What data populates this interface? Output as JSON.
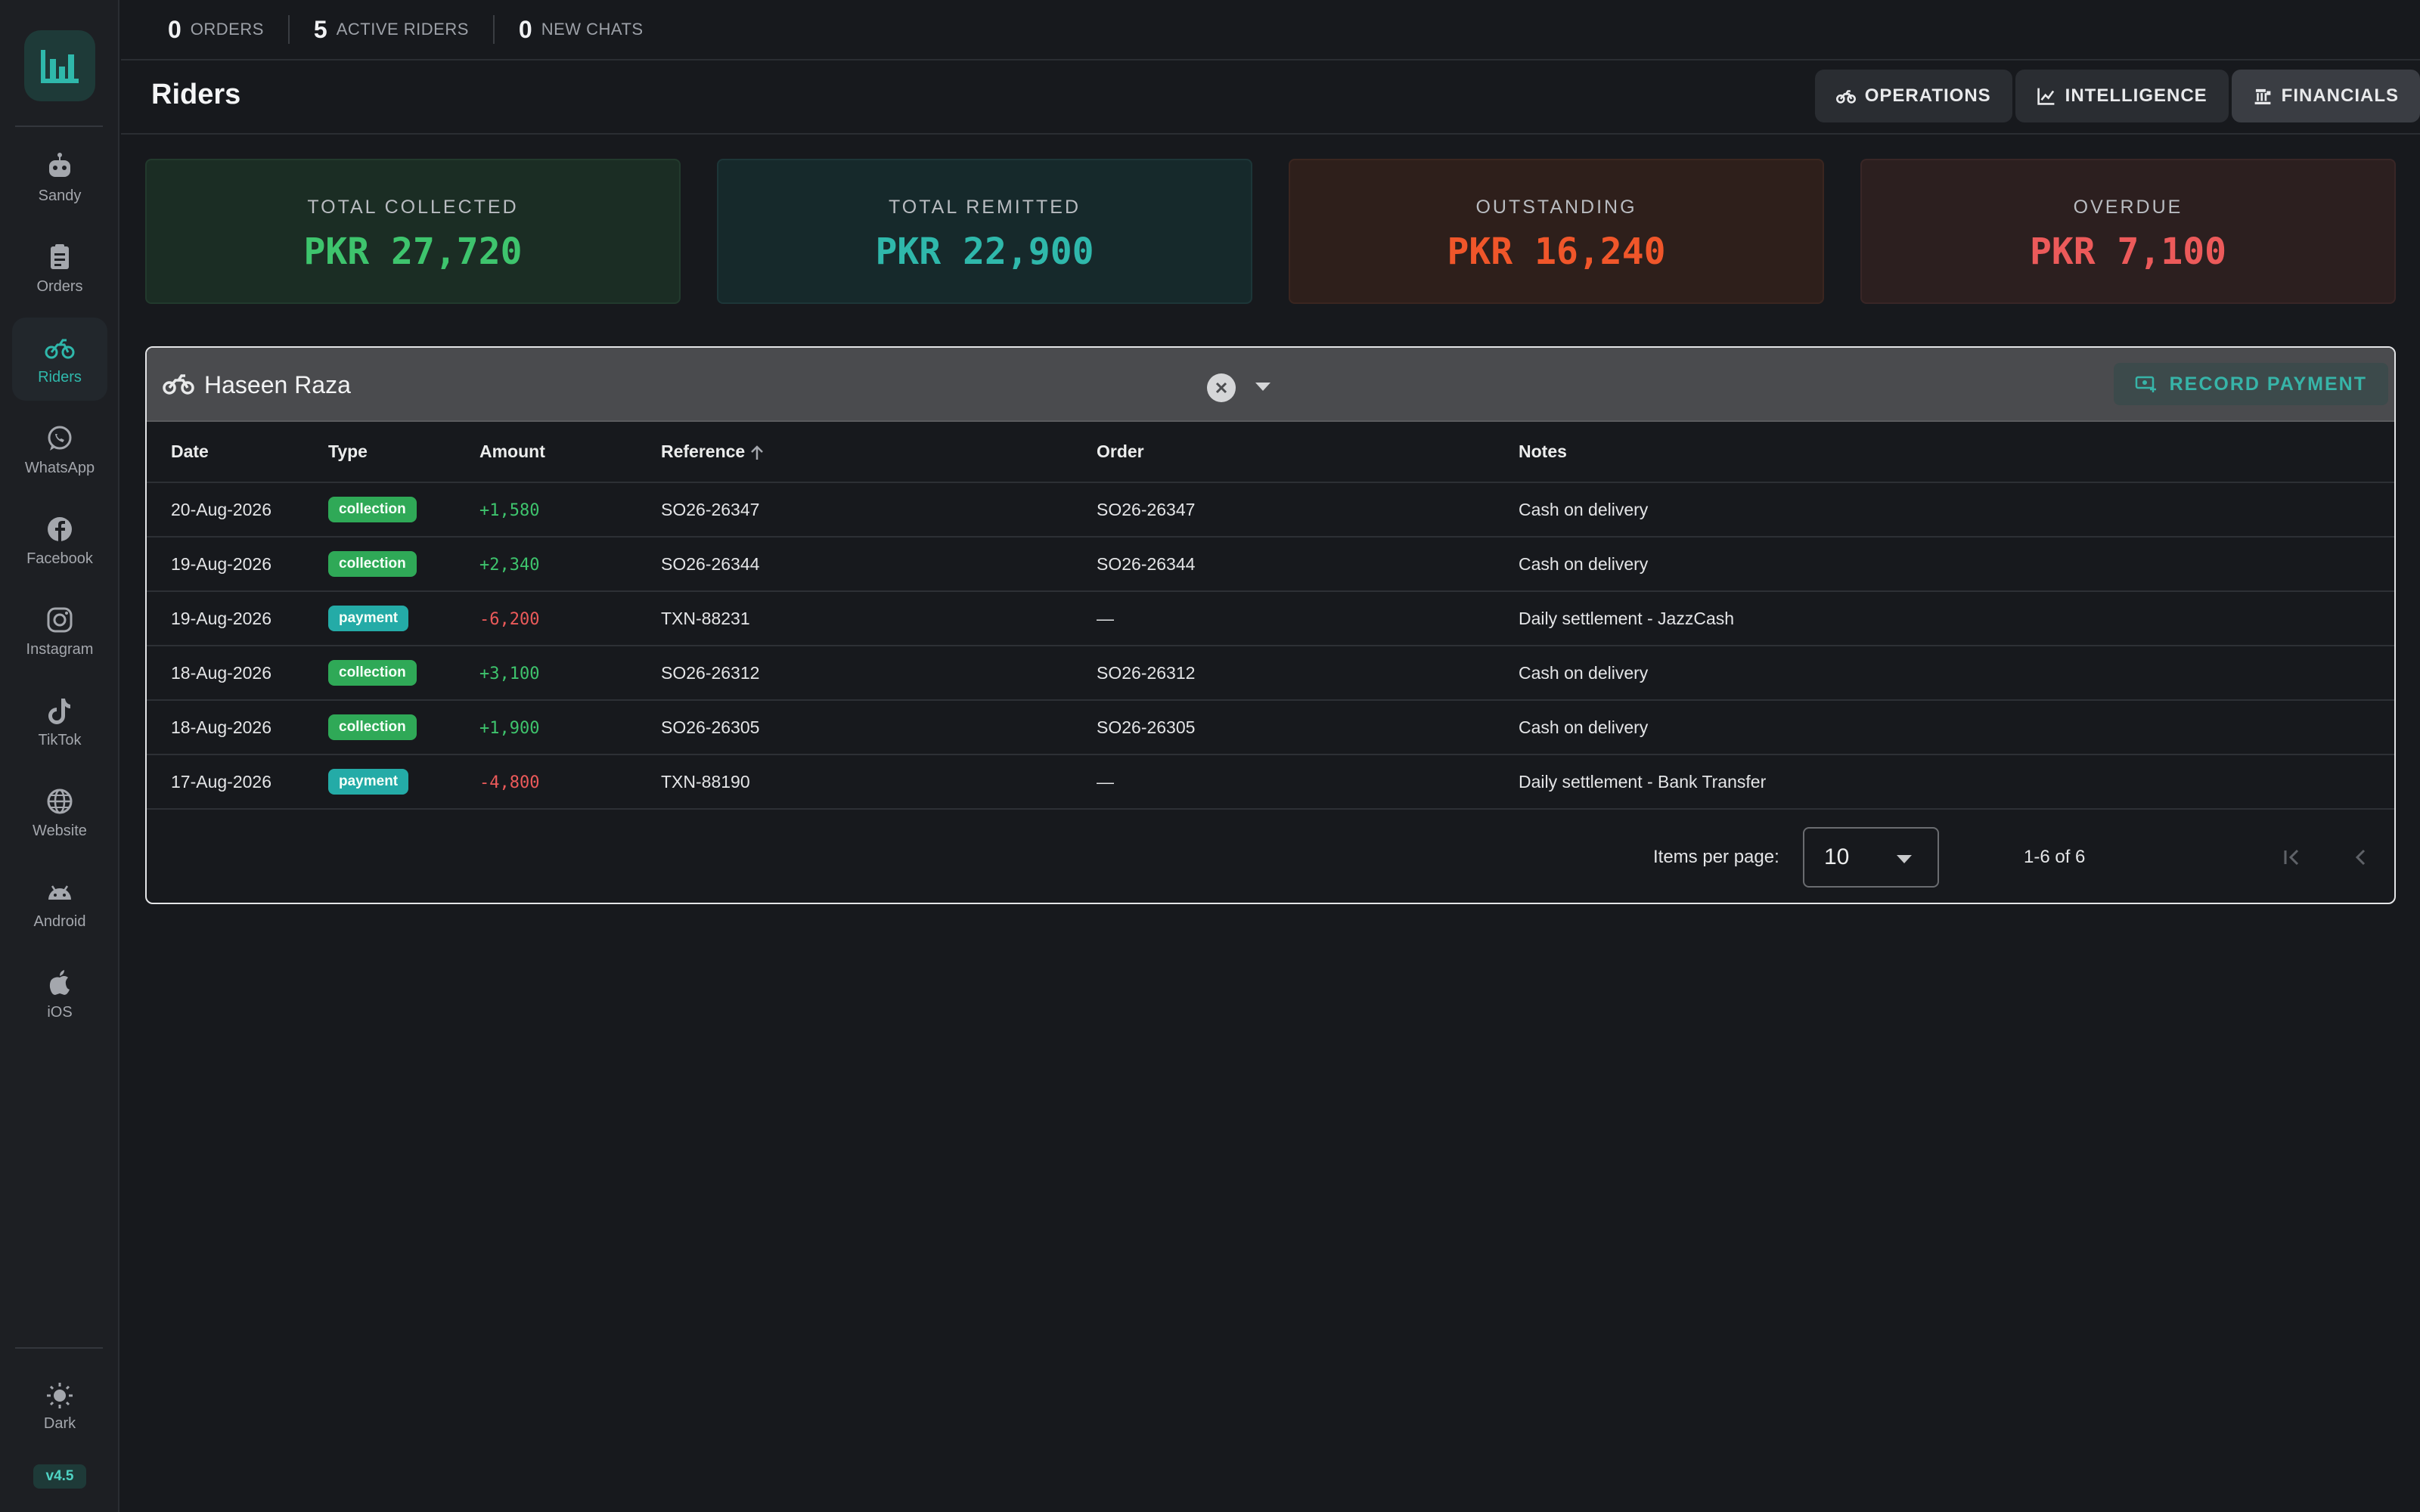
{
  "topbar": {
    "stats": [
      {
        "value": "0",
        "label": "ORDERS"
      },
      {
        "value": "5",
        "label": "ACTIVE RIDERS"
      },
      {
        "value": "0",
        "label": "NEW CHATS"
      }
    ]
  },
  "sidebar": {
    "items": [
      {
        "label": "Sandy",
        "icon": "robot-icon"
      },
      {
        "label": "Orders",
        "icon": "clipboard-icon"
      },
      {
        "label": "Riders",
        "icon": "motorbike-icon",
        "active": true
      },
      {
        "label": "WhatsApp",
        "icon": "whatsapp-icon"
      },
      {
        "label": "Facebook",
        "icon": "facebook-icon"
      },
      {
        "label": "Instagram",
        "icon": "instagram-icon"
      },
      {
        "label": "TikTok",
        "icon": "tiktok-icon"
      },
      {
        "label": "Website",
        "icon": "globe-icon"
      },
      {
        "label": "Android",
        "icon": "android-icon"
      },
      {
        "label": "iOS",
        "icon": "apple-icon"
      }
    ],
    "theme_label": "Dark",
    "version": "v4.5"
  },
  "header": {
    "title": "Riders",
    "tabs": [
      {
        "label": "OPERATIONS",
        "icon": "motorbike-icon"
      },
      {
        "label": "INTELLIGENCE",
        "icon": "line-chart-icon"
      },
      {
        "label": "FINANCIALS",
        "icon": "bank-icon",
        "active": true
      }
    ]
  },
  "summary": [
    {
      "title": "TOTAL COLLECTED",
      "value": "PKR 27,720"
    },
    {
      "title": "TOTAL REMITTED",
      "value": "PKR 22,900"
    },
    {
      "title": "OUTSTANDING",
      "value": "PKR 16,240"
    },
    {
      "title": "OVERDUE",
      "value": "PKR 7,100"
    }
  ],
  "ledger": {
    "rider": "Haseen Raza",
    "record_payment": "RECORD PAYMENT",
    "columns": {
      "date": "Date",
      "type": "Type",
      "amount": "Amount",
      "reference": "Reference",
      "order": "Order",
      "notes": "Notes"
    },
    "rows": [
      {
        "date": "20-Aug-2026",
        "type": "collection",
        "amount": "+1,580",
        "reference": "SO26-26347",
        "order": "SO26-26347",
        "notes": "Cash on delivery"
      },
      {
        "date": "19-Aug-2026",
        "type": "collection",
        "amount": "+2,340",
        "reference": "SO26-26344",
        "order": "SO26-26344",
        "notes": "Cash on delivery"
      },
      {
        "date": "19-Aug-2026",
        "type": "payment",
        "amount": "-6,200",
        "reference": "TXN-88231",
        "order": "—",
        "notes": "Daily settlement - JazzCash"
      },
      {
        "date": "18-Aug-2026",
        "type": "collection",
        "amount": "+3,100",
        "reference": "SO26-26312",
        "order": "SO26-26312",
        "notes": "Cash on delivery"
      },
      {
        "date": "18-Aug-2026",
        "type": "collection",
        "amount": "+1,900",
        "reference": "SO26-26305",
        "order": "SO26-26305",
        "notes": "Cash on delivery"
      },
      {
        "date": "17-Aug-2026",
        "type": "payment",
        "amount": "-4,800",
        "reference": "TXN-88190",
        "order": "—",
        "notes": "Daily settlement - Bank Transfer"
      }
    ],
    "pagination": {
      "items_per_page_label": "Items per page:",
      "items_per_page": "10",
      "range": "1-6 of 6"
    }
  },
  "colors": {
    "accent": "#2fb8ab",
    "positive": "#3ec46d",
    "negative": "#ec5a5a",
    "outstanding": "#f0562a"
  }
}
